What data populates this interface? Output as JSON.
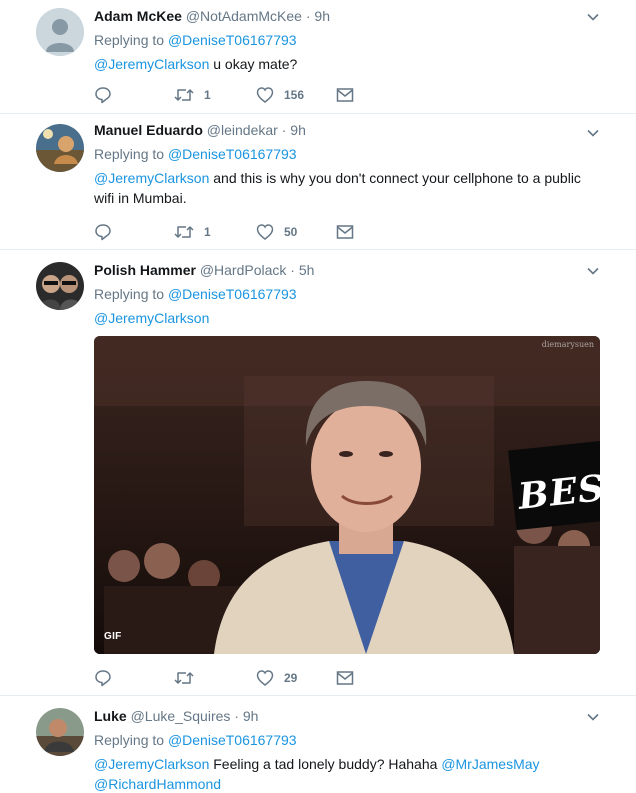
{
  "tweets": [
    {
      "name": "Adam McKee",
      "handle": "@NotAdamMcKee",
      "dot": "·",
      "time": "9h",
      "replying_prefix": "Replying to",
      "replying_to": "@DeniseT06167793",
      "mention": "@JeremyClarkson",
      "text": " u okay mate?",
      "retweets": "1",
      "likes": "156"
    },
    {
      "name": "Manuel Eduardo",
      "handle": "@leindekar",
      "dot": "·",
      "time": "9h",
      "replying_prefix": "Replying to",
      "replying_to": "@DeniseT06167793",
      "mention": "@JeremyClarkson",
      "text_line1": " and this is why you don't connect your cellphone to a public",
      "text_line2": "wifi in Mumbai.",
      "retweets": "1",
      "likes": "50"
    },
    {
      "name": "Polish Hammer",
      "handle": "@HardPolack",
      "dot": "·",
      "time": "5h",
      "replying_prefix": "Replying to",
      "replying_to": "@DeniseT06167793",
      "mention": "@JeremyClarkson",
      "media_badge": "GIF",
      "media_watermark": "diemarysuen",
      "media_sign": "BEST",
      "retweets": "",
      "likes": "29"
    },
    {
      "name": "Luke",
      "handle": "@Luke_Squires",
      "dot": "·",
      "time": "9h",
      "replying_prefix": "Replying to",
      "replying_to": "@DeniseT06167793",
      "mention": "@JeremyClarkson",
      "text": " Feeling a tad lonely buddy? Hahaha ",
      "mention2": "@MrJamesMay",
      "mention3": "@RichardHammond"
    }
  ],
  "colors": {
    "link": "#1b95e0",
    "secondary": "#657786",
    "divider": "#e6ecf0"
  },
  "icons": [
    "reply-icon",
    "retweet-icon",
    "like-icon",
    "dm-icon",
    "chevron-down-icon"
  ]
}
